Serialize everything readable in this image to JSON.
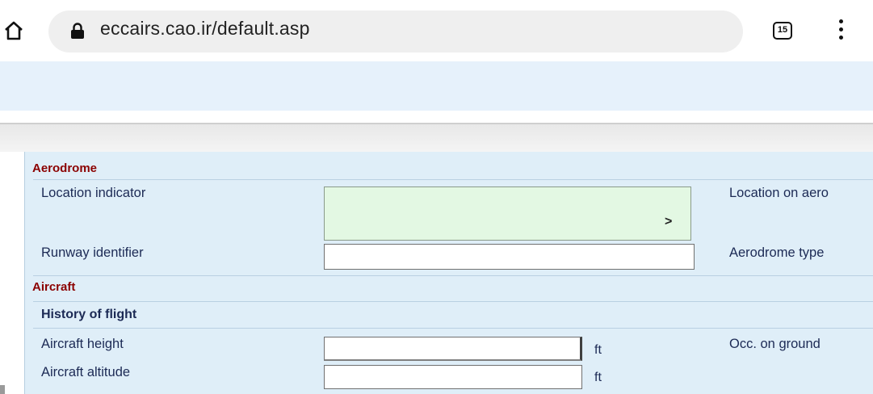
{
  "browser": {
    "url": "eccairs.cao.ir/default.asp",
    "tab_count": "15",
    "icons": [
      "home-icon",
      "lock-icon",
      "tabs-icon",
      "menu-icon"
    ]
  },
  "form": {
    "sections": [
      {
        "title": "Aerodrome"
      },
      {
        "title": "Aircraft"
      }
    ],
    "subsections": [
      {
        "title": "History of flight"
      }
    ],
    "fields": {
      "location_indicator": {
        "label": "Location indicator",
        "value": "",
        "chevron": ">"
      },
      "location_on_aerodrome": {
        "label": "Location on aero"
      },
      "runway_identifier": {
        "label": "Runway identifier",
        "value": ""
      },
      "aerodrome_type": {
        "label": "Aerodrome type"
      },
      "aircraft_height": {
        "label": "Aircraft height",
        "value": "",
        "unit": "ft"
      },
      "occ_on_ground": {
        "label": "Occ. on ground"
      },
      "aircraft_altitude": {
        "label": "Aircraft altitude",
        "value": "",
        "unit": "ft"
      }
    }
  },
  "colors": {
    "section_title": "#8b0000",
    "label": "#1c2a55",
    "form_bg": "#dfeef8",
    "header_band": "#e6f1fb",
    "location_field_bg": "#e3f8e3"
  }
}
